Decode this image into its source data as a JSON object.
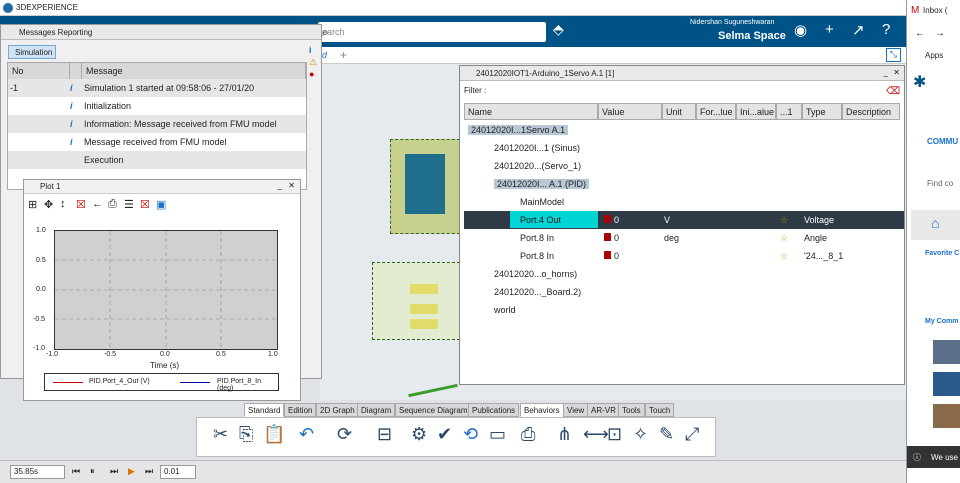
{
  "app": {
    "title": "3DEXPERIENCE",
    "user": "Nidershan Suguneshwaran",
    "space": "Selma Space",
    "search_placeholder": "earch",
    "tab_partial": "d"
  },
  "messages": {
    "title": "Messages Reporting",
    "simulation_btn": "Simulation",
    "col_no": "No",
    "col_message": "Message",
    "rows": [
      {
        "no": "-1",
        "text": "Simulation 1 started at 09:58:06 - 27/01/20"
      },
      {
        "no": "",
        "text": "Initialization"
      },
      {
        "no": "",
        "text": "Information: Message received from FMU model"
      },
      {
        "no": "",
        "text": "Message received from FMU model"
      },
      {
        "no": "",
        "text": "Execution"
      }
    ]
  },
  "plot": {
    "title": "Plot 1",
    "xlabel": "Time (s)",
    "chart_data": {
      "type": "line",
      "xlim": [
        -1.0,
        1.0
      ],
      "ylim": [
        -1.0,
        1.0
      ],
      "xticks": [
        "-1.0",
        "-0.5",
        "0.0",
        "0.5",
        "1.0"
      ],
      "yticks": [
        "1.0",
        "0.5",
        "0.0",
        "-0.5",
        "-1.0"
      ],
      "series": [
        {
          "name": "PID.Port_4_Out (V)",
          "color": "#cc0000",
          "values": []
        },
        {
          "name": "PID.Port_8_In (deg)",
          "color": "#000099",
          "values": []
        }
      ]
    }
  },
  "params": {
    "title": "24012020IOT1-Arduino_1Servo A.1 [1]",
    "filter": "Filter :",
    "columns": [
      "Name",
      "Value",
      "Unit",
      "For...lue",
      "Ini...alue",
      "...1",
      "Type",
      "Description"
    ],
    "rows": [
      {
        "name": "24012020I...1Servo A.1",
        "value": "",
        "unit": "",
        "type": ""
      },
      {
        "name": "24012020I...1 (Sinus)",
        "value": "",
        "unit": "",
        "type": ""
      },
      {
        "name": "24012020...(Servo_1)",
        "value": "",
        "unit": "",
        "type": ""
      },
      {
        "name": "24012020I... A.1 (PID)",
        "value": "",
        "unit": "",
        "type": ""
      },
      {
        "name": "MainModel",
        "value": "",
        "unit": "",
        "type": ""
      },
      {
        "name": "Port.4 Out",
        "value": "0",
        "unit": "V",
        "type": "Voltage"
      },
      {
        "name": "Port.8 In",
        "value": "0",
        "unit": "deg",
        "type": "Angle"
      },
      {
        "name": "Port.8 In",
        "value": "0",
        "unit": "",
        "type": "'24..._8_1"
      },
      {
        "name": "24012020...o_horns)",
        "value": "",
        "unit": "",
        "type": ""
      },
      {
        "name": "24012020..._Board.2)",
        "value": "",
        "unit": "",
        "type": ""
      },
      {
        "name": "world",
        "value": "",
        "unit": "",
        "type": ""
      }
    ]
  },
  "tool_tabs": [
    "Standard",
    "Edition",
    "2D Graph",
    "Diagram",
    "Sequence Diagram",
    "Publications",
    "Behaviors",
    "View",
    "AR-VR",
    "Tools",
    "Touch"
  ],
  "status": {
    "time": "35.85s",
    "step": "0.01"
  },
  "browser": {
    "inbox": "Inbox (",
    "apps": "Apps",
    "commu": "COMMU",
    "find": "Find co",
    "favorite": "Favorite C",
    "mycomm": "My Comm",
    "cookie": "We use"
  }
}
